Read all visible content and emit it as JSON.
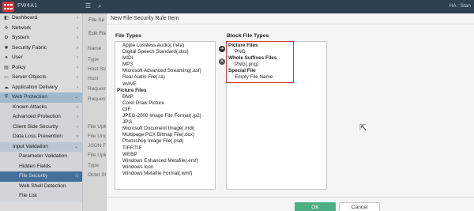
{
  "topbar": {
    "brand": "FW4A1",
    "menu_icon": "hamburger-icon",
    "search_icon": "search-icon",
    "right_text": "HA : Stan"
  },
  "sidebar": {
    "items": [
      {
        "label": "Dashboard",
        "icon": "dashboard-icon"
      },
      {
        "label": "Network",
        "icon": "network-icon"
      },
      {
        "label": "System",
        "icon": "gear-icon"
      },
      {
        "label": "Security Fabric",
        "icon": "security-fabric-icon"
      },
      {
        "label": "User",
        "icon": "user-icon"
      },
      {
        "label": "Policy",
        "icon": "policy-icon"
      },
      {
        "label": "Server Objects",
        "icon": "server-icon"
      },
      {
        "label": "Application Delivery",
        "icon": "cloud-icon"
      },
      {
        "label": "Web Protection",
        "icon": "shield-icon"
      }
    ],
    "sub_items": [
      "Known Attacks",
      "Advanced Protection",
      "Client Side Security",
      "Data Loss Prevention"
    ],
    "input_validation": {
      "label": "Input Validation",
      "items": [
        "Parameter Validation",
        "Hidden Fields",
        "File Security",
        "Web Shell Detection",
        "File List"
      ],
      "selected": "File Security"
    }
  },
  "background_form": {
    "tab1": "File Se",
    "tab2": "Edit File",
    "labels": [
      "Name",
      "Type",
      "Host Sta",
      "Host",
      "Request",
      "Request",
      "File Uplo",
      "File Unco",
      "JSON File",
      "File Uplo",
      "Type",
      "Octet St"
    ]
  },
  "modal": {
    "title": "New File Security Rule Item",
    "file_types_label": "File Types",
    "block_file_types_label": "Block File Types",
    "file_types": [
      {
        "text": "Apple Lossless Audio(.m4a)",
        "kind": "item"
      },
      {
        "text": "Digital Speech Standard(.dss)",
        "kind": "item"
      },
      {
        "text": "MIDI",
        "kind": "item"
      },
      {
        "text": "MP3",
        "kind": "item"
      },
      {
        "text": "Microsoft Advanced Streaming(.asf)",
        "kind": "item"
      },
      {
        "text": "Real Audio File(.ra)",
        "kind": "item"
      },
      {
        "text": "WAVE",
        "kind": "item"
      },
      {
        "text": "Picture Files",
        "kind": "cat"
      },
      {
        "text": "BMP",
        "kind": "item"
      },
      {
        "text": "Corel Draw Picture",
        "kind": "item"
      },
      {
        "text": "GIF",
        "kind": "item"
      },
      {
        "text": "JPEG-2000 Image File Format(.jp2)",
        "kind": "item"
      },
      {
        "text": "JPG",
        "kind": "item"
      },
      {
        "text": "Microsoft Document Image(.mdi)",
        "kind": "item"
      },
      {
        "text": "Multipage PCX Bitmap File(.dcx)",
        "kind": "item"
      },
      {
        "text": "Photoshop Image File(.psd)",
        "kind": "item"
      },
      {
        "text": "TIFF/TIF",
        "kind": "item"
      },
      {
        "text": "WEBP",
        "kind": "item"
      },
      {
        "text": "Windows Enhanced Metafile(.emf)",
        "kind": "item"
      },
      {
        "text": "Windows Icon",
        "kind": "item"
      },
      {
        "text": "Windows Metafile Format(.wmf)",
        "kind": "item"
      }
    ],
    "block_file_types": [
      {
        "text": "Picture Files",
        "kind": "cat"
      },
      {
        "text": "PNG",
        "kind": "bitem"
      },
      {
        "text": "Whole Suffixes Files",
        "kind": "cat"
      },
      {
        "text": "PNG(.png)",
        "kind": "bitem"
      },
      {
        "text": "Special File",
        "kind": "cat"
      },
      {
        "text": "Empty File Name",
        "kind": "bitem"
      }
    ],
    "add_arrow_icon": "arrow-right-icon",
    "remove_icon": "remove-icon",
    "ok_label": "OK",
    "cancel_label": "Cancel",
    "highlight_color": "#d93a3a",
    "ok_color": "#4caf84"
  }
}
